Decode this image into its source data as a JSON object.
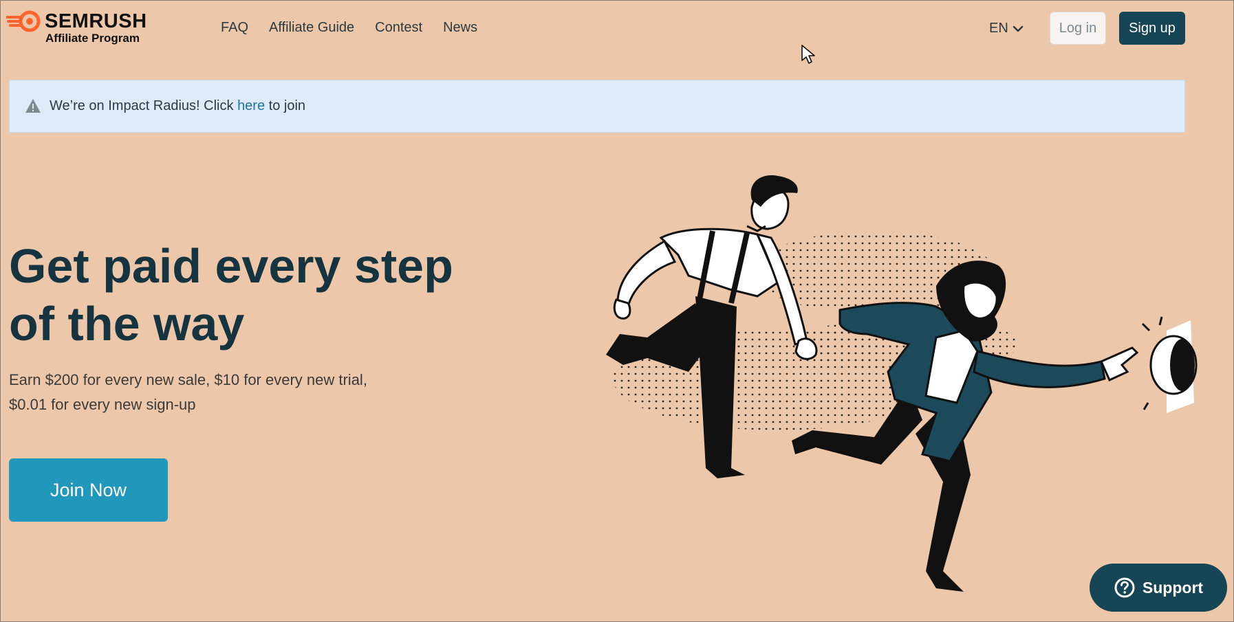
{
  "header": {
    "logo_name": "SEMRUSH",
    "logo_sub": "Affiliate Program",
    "nav": [
      "FAQ",
      "Affiliate Guide",
      "Contest",
      "News"
    ],
    "language": "EN",
    "login": "Log in",
    "signup": "Sign up"
  },
  "banner": {
    "text_before": "We’re on Impact Radius! Click ",
    "link": "here",
    "text_after": " to join",
    "icon": "warning-icon"
  },
  "hero": {
    "title": "Get paid every step of the way",
    "subtitle_line1": "Earn $200 for every new sale, $10 for every new trial,",
    "subtitle_line2": "$0.01 for every new sign-up",
    "cta": "Join Now"
  },
  "support": {
    "label": "Support",
    "icon": "question-circle-icon"
  },
  "colors": {
    "background": "#edc7aa",
    "primary_dark": "#164555",
    "cta": "#2198bb",
    "banner": "#ddebf8",
    "logo_orange": "#ff642d"
  }
}
